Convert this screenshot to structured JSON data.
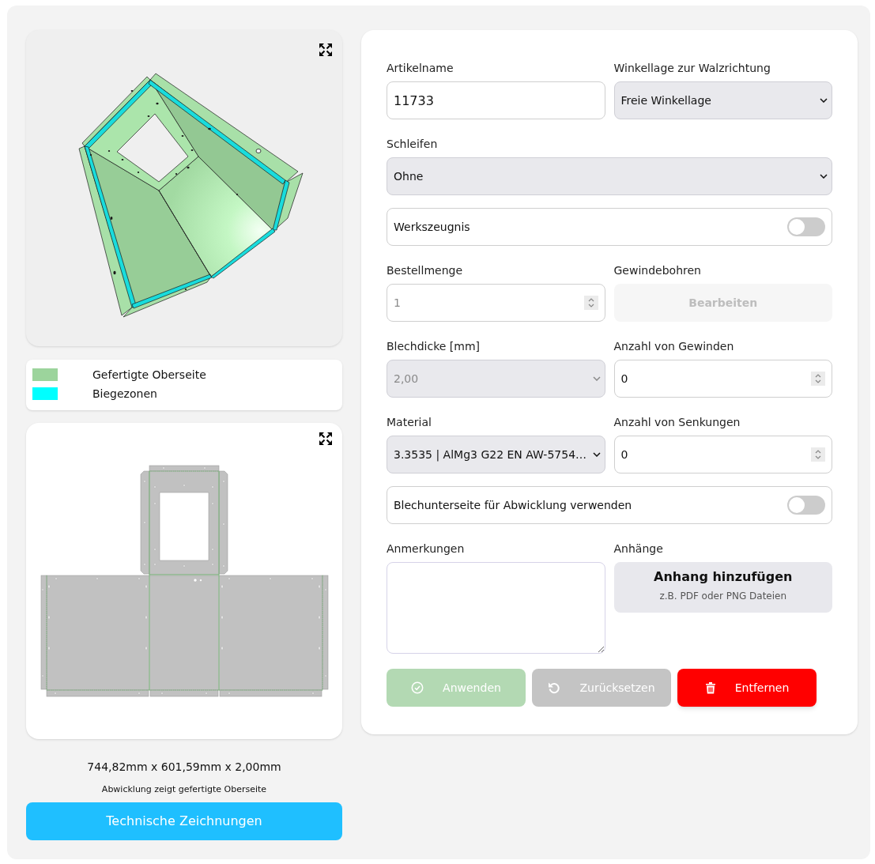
{
  "legend": [
    {
      "label": "Gefertigte Oberseite",
      "color": "#9cd49c"
    },
    {
      "label": "Biegezonen",
      "color": "#00ffff"
    }
  ],
  "dimensions": "744,82mm x 601,59mm x 2,00mm",
  "caption": "Abwicklung zeigt gefertigte Oberseite",
  "drawings_button": "Technische Zeichnungen",
  "form": {
    "rows": [
      [
        {
          "kind": "text",
          "label": "Artikelname",
          "value": "11733"
        },
        {
          "kind": "select",
          "label": "Winkellage zur Walzrichtung",
          "value": "Freie Winkellage",
          "disabled": false
        }
      ],
      [
        {
          "kind": "select",
          "label": "Schleifen",
          "value": "Ohne",
          "disabled": false
        }
      ],
      [
        {
          "kind": "toggle",
          "label": "Werkszeugnis",
          "on": false
        }
      ],
      [
        {
          "kind": "number",
          "label": "Bestellmenge",
          "placeholder": "1"
        },
        {
          "kind": "button",
          "label": "Gewindebohren",
          "action": "Bearbeiten",
          "disabled": true
        }
      ],
      [
        {
          "kind": "select",
          "label": "Blechdicke [mm]",
          "value": "2,00",
          "disabled": true
        },
        {
          "kind": "number",
          "label": "Anzahl von Gewinden",
          "value": "0"
        }
      ],
      [
        {
          "kind": "select",
          "label": "Material",
          "value": "3.3535 | AlMg3 G22 EN AW-5754…",
          "disabled": false
        },
        {
          "kind": "number",
          "label": "Anzahl von Senkungen",
          "value": "0"
        }
      ],
      [
        {
          "kind": "toggle",
          "label": "Blechunterseite für Abwicklung verwenden",
          "on": false
        }
      ],
      [
        {
          "kind": "textarea",
          "label": "Anmerkungen"
        },
        {
          "kind": "upload",
          "label": "Anhänge",
          "title": "Anhang hinzufügen",
          "hint": "z.B. PDF oder PNG Dateien"
        }
      ]
    ],
    "buttons": [
      {
        "kind": "apply",
        "label": "Anwenden",
        "disabled": true
      },
      {
        "kind": "reset",
        "label": "Zurücksetzen",
        "disabled": true
      },
      {
        "kind": "delete",
        "label": "Entfernen",
        "disabled": false
      }
    ]
  }
}
